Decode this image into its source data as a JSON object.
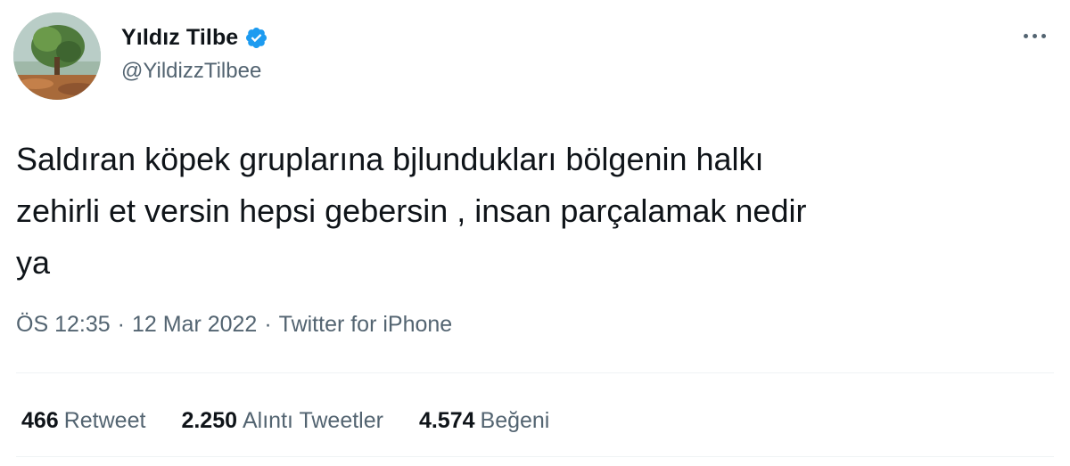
{
  "author": {
    "display_name": "Yıldız Tilbe",
    "handle": "@YildizzTilbee",
    "verified": true
  },
  "tweet": {
    "text": "Saldıran köpek gruplarına bjlundukları bölgenin halkı\nzehirli et versin hepsi gebersin , insan parçalamak nedir\nya",
    "time": "ÖS 12:35",
    "date": "12 Mar 2022",
    "source": "Twitter for iPhone",
    "separator": "·"
  },
  "stats": {
    "retweets": {
      "count": "466",
      "label": "Retweet"
    },
    "quotes": {
      "count": "2.250",
      "label": "Alıntı Tweetler"
    },
    "likes": {
      "count": "4.574",
      "label": "Beğeni"
    }
  },
  "icons": {
    "verified": "verified-badge-icon",
    "more": "more-options-icon"
  },
  "colors": {
    "verified_blue": "#1d9bf0",
    "text_primary": "#0f1419",
    "text_secondary": "#536471"
  }
}
